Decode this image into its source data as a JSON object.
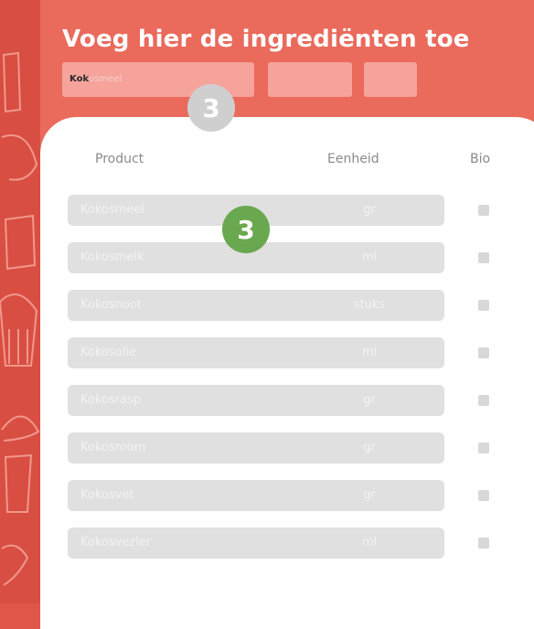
{
  "header": {
    "title": "Voeg hier de ingrediënten toe"
  },
  "search": {
    "typed": "Kok",
    "suggestion": "osmeel"
  },
  "steps": {
    "search_badge": "3",
    "list_badge": "3"
  },
  "table": {
    "columns": [
      "Product",
      "Eenheid",
      "Bio"
    ],
    "rows": [
      {
        "product": "Kokosmeel",
        "unit": "gr"
      },
      {
        "product": "Kokosmelk",
        "unit": "ml"
      },
      {
        "product": "Kokosnoot",
        "unit": "stuks"
      },
      {
        "product": "Kokosolie",
        "unit": "ml"
      },
      {
        "product": "Kokosrasp",
        "unit": "gr"
      },
      {
        "product": "Kokosroom",
        "unit": "gr"
      },
      {
        "product": "Kokosvet",
        "unit": "gr"
      },
      {
        "product": "Kokosvezler",
        "unit": "ml"
      }
    ]
  },
  "colors": {
    "brand": "#ea6a5c",
    "step_active": "#6aa84f",
    "step_inactive": "#cfcfcf"
  }
}
